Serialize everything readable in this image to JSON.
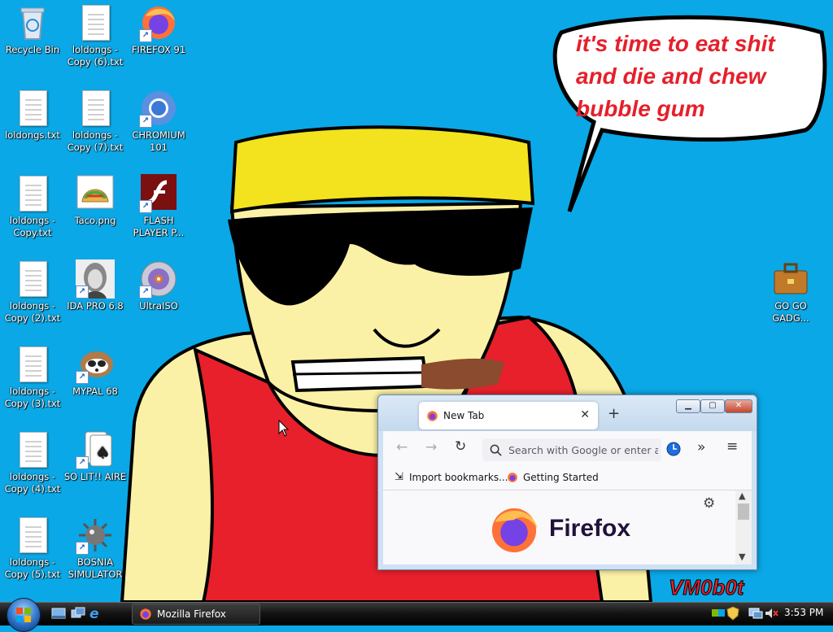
{
  "wallpaper": {
    "speech_text": [
      "it's time to eat shit",
      "and die and chew",
      "bubble gum"
    ],
    "signature": "VM0b0t",
    "colors": {
      "sky": "#0aa8e6",
      "skin": "#fbf1a6",
      "shirt": "#e8202b",
      "hair": "#f3e21e",
      "speech_text": "#e5202b"
    }
  },
  "desktop_icons": [
    {
      "label": "Recycle Bin",
      "icon": "recycle-bin-icon"
    },
    {
      "label": "loldongs -\nCopy (6).txt",
      "icon": "text-file-icon"
    },
    {
      "label": "FIREFOX 91",
      "icon": "firefox-icon"
    },
    {
      "label": "loldongs.txt",
      "icon": "text-file-icon"
    },
    {
      "label": "loldongs -\nCopy (7).txt",
      "icon": "text-file-icon"
    },
    {
      "label": "CHROMIUM\n101",
      "icon": "chromium-icon"
    },
    {
      "label": "loldongs -\nCopy.txt",
      "icon": "text-file-icon"
    },
    {
      "label": "Taco.png",
      "icon": "taco-icon"
    },
    {
      "label": "FLASH\nPLAYER P...",
      "icon": "flash-player-icon"
    },
    {
      "label": "loldongs -\nCopy (2).txt",
      "icon": "text-file-icon"
    },
    {
      "label": "IDA PRO 6.8",
      "icon": "ida-pro-icon"
    },
    {
      "label": "UltraISO",
      "icon": "ultraiso-icon"
    },
    {
      "label": "loldongs -\nCopy (3).txt",
      "icon": "text-file-icon"
    },
    {
      "label": "MYPAL 68",
      "icon": "mypal-raccoon-icon"
    },
    {
      "label": "loldongs -\nCopy (4).txt",
      "icon": "text-file-icon"
    },
    {
      "label": "SO LIT!! AIRE",
      "icon": "solitaire-icon"
    },
    {
      "label": "loldongs -\nCopy (5).txt",
      "icon": "text-file-icon"
    },
    {
      "label": "BOSNIA\nSIMULATOR",
      "icon": "minesweeper-icon"
    },
    {
      "label": "GO GO\nGADG...",
      "icon": "briefcase-icon"
    }
  ],
  "firefox": {
    "tab_title": "New Tab",
    "url_placeholder": "Search with Google or enter address",
    "bookmarks": [
      "Import bookmarks...",
      "Getting Started"
    ],
    "brand": "Firefox"
  },
  "taskbar": {
    "task_label": "Mozilla Firefox",
    "clock": "3:53 PM"
  }
}
